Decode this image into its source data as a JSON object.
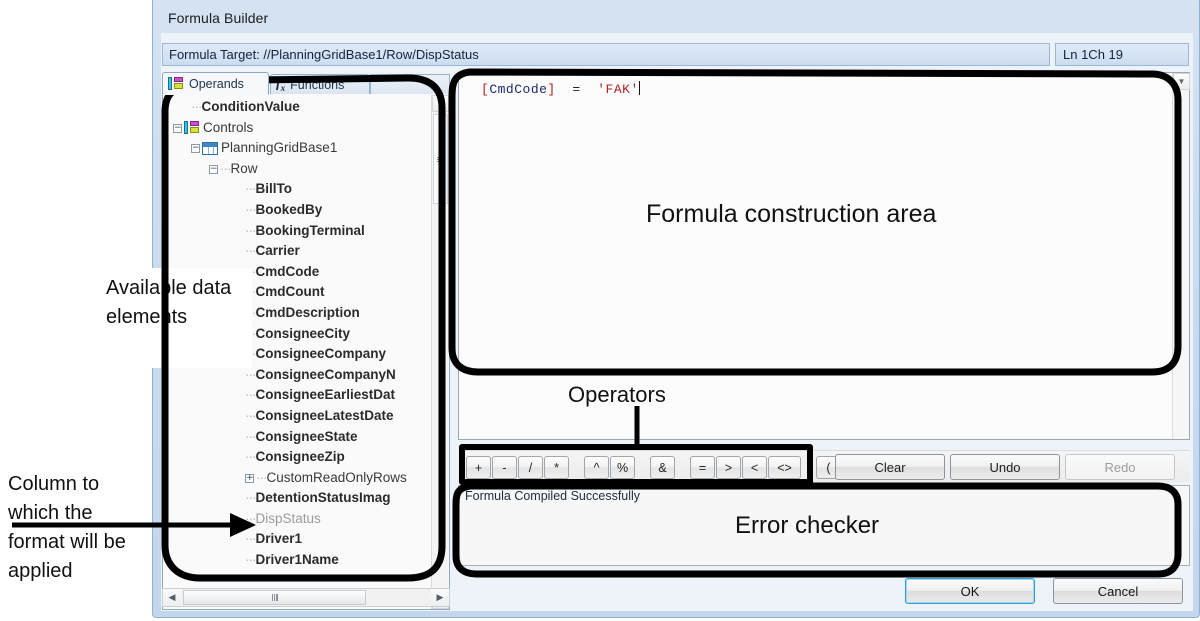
{
  "window": {
    "title": "Formula Builder"
  },
  "target_bar": {
    "label": "Formula Target: //PlanningGridBase1/Row/DispStatus",
    "position_indicator": "Ln 1Ch 19"
  },
  "tabs": [
    {
      "label": "Operands",
      "icon": "operands-icon",
      "active": true
    },
    {
      "label": "Functions",
      "icon": "fx-icon",
      "active": false
    }
  ],
  "tree": {
    "nodes": [
      {
        "label": "ConditionValue",
        "indent": 1,
        "style": "bold",
        "expander": "none",
        "icon": "none",
        "dash": true
      },
      {
        "label": "Controls",
        "indent": 0,
        "style": "plain",
        "expander": "minus",
        "icon": "controls-icon",
        "dash": false
      },
      {
        "label": "PlanningGridBase1",
        "indent": 1,
        "style": "plain",
        "expander": "minus",
        "icon": "grid-icon",
        "dash": false
      },
      {
        "label": "Row",
        "indent": 2,
        "style": "plain",
        "expander": "minus",
        "icon": "none",
        "dash": true
      },
      {
        "label": "BillTo",
        "indent": 4,
        "style": "bold",
        "expander": "none",
        "icon": "none",
        "dash": true
      },
      {
        "label": "BookedBy",
        "indent": 4,
        "style": "bold",
        "expander": "none",
        "icon": "none",
        "dash": true
      },
      {
        "label": "BookingTerminal",
        "indent": 4,
        "style": "bold",
        "expander": "none",
        "icon": "none",
        "dash": true
      },
      {
        "label": "Carrier",
        "indent": 4,
        "style": "bold",
        "expander": "none",
        "icon": "none",
        "dash": true
      },
      {
        "label": "CmdCode",
        "indent": 4,
        "style": "bold",
        "expander": "none",
        "icon": "none",
        "dash": true
      },
      {
        "label": "CmdCount",
        "indent": 4,
        "style": "bold",
        "expander": "none",
        "icon": "none",
        "dash": true
      },
      {
        "label": "CmdDescription",
        "indent": 4,
        "style": "bold",
        "expander": "none",
        "icon": "none",
        "dash": true
      },
      {
        "label": "ConsigneeCity",
        "indent": 4,
        "style": "bold",
        "expander": "none",
        "icon": "none",
        "dash": true
      },
      {
        "label": "ConsigneeCompany",
        "indent": 4,
        "style": "bold",
        "expander": "none",
        "icon": "none",
        "dash": true
      },
      {
        "label": "ConsigneeCompanyN",
        "indent": 4,
        "style": "bold",
        "expander": "none",
        "icon": "none",
        "dash": true
      },
      {
        "label": "ConsigneeEarliestDat",
        "indent": 4,
        "style": "bold",
        "expander": "none",
        "icon": "none",
        "dash": true
      },
      {
        "label": "ConsigneeLatestDate",
        "indent": 4,
        "style": "bold",
        "expander": "none",
        "icon": "none",
        "dash": true
      },
      {
        "label": "ConsigneeState",
        "indent": 4,
        "style": "bold",
        "expander": "none",
        "icon": "none",
        "dash": true
      },
      {
        "label": "ConsigneeZip",
        "indent": 4,
        "style": "bold",
        "expander": "none",
        "icon": "none",
        "dash": true
      },
      {
        "label": "CustomReadOnlyRows",
        "indent": 4,
        "style": "plain",
        "expander": "plus",
        "icon": "none",
        "dash": true
      },
      {
        "label": "DetentionStatusImag",
        "indent": 4,
        "style": "bold",
        "expander": "none",
        "icon": "none",
        "dash": true
      },
      {
        "label": "DispStatus",
        "indent": 4,
        "style": "dim",
        "expander": "none",
        "icon": "none",
        "dash": true
      },
      {
        "label": "Driver1",
        "indent": 4,
        "style": "bold",
        "expander": "none",
        "icon": "none",
        "dash": true
      },
      {
        "label": "Driver1Name",
        "indent": 4,
        "style": "bold",
        "expander": "none",
        "icon": "none",
        "dash": true
      }
    ]
  },
  "formula": {
    "tokens": [
      {
        "text": "[",
        "kind": "bracket"
      },
      {
        "text": "CmdCode",
        "kind": "identifier"
      },
      {
        "text": "]",
        "kind": "bracket"
      },
      {
        "text": "  =  ",
        "kind": "operator"
      },
      {
        "text": "'FAK'",
        "kind": "string"
      }
    ],
    "plain_text": "[CmdCode]  =  'FAK'"
  },
  "operators": {
    "buttons": [
      {
        "label": "+",
        "group": 0
      },
      {
        "label": "-",
        "group": 0
      },
      {
        "label": "/",
        "group": 0
      },
      {
        "label": "*",
        "group": 0
      },
      {
        "label": "^",
        "group": 1
      },
      {
        "label": "%",
        "group": 1
      },
      {
        "label": "&",
        "group": 2
      },
      {
        "label": "=",
        "group": 3
      },
      {
        "label": ">",
        "group": 3
      },
      {
        "label": "<",
        "group": 3
      },
      {
        "label": "<>",
        "group": 3,
        "wide": true
      },
      {
        "label": "(",
        "group": 4
      },
      {
        "label": ")",
        "group": 4
      }
    ]
  },
  "actions": {
    "clear": "Clear",
    "undo": "Undo",
    "redo": "Redo",
    "redo_disabled": true
  },
  "error_checker": {
    "message": "Formula Compiled Successfully"
  },
  "dialog_buttons": {
    "ok": "OK",
    "cancel": "Cancel"
  },
  "annotations": {
    "available_data_elements": "Available data elements",
    "column_to_which": "Column to which the format will be applied",
    "formula_construction_area": "Formula construction area",
    "operators": "Operators",
    "error_checker": "Error checker"
  },
  "colors": {
    "window_chrome": "#cbdcef",
    "accent_blue": "#2f9fd6",
    "tree_background": "#fafafa",
    "annotation": "#111111"
  }
}
